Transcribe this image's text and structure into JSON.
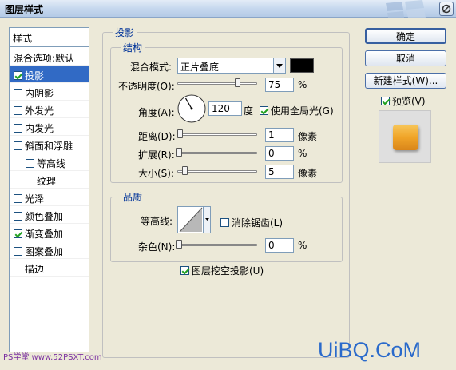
{
  "window": {
    "title": "图层样式"
  },
  "styles_list": {
    "header": "样式",
    "items": [
      {
        "label": "混合选项:默认",
        "checkbox": false,
        "checked": false,
        "selected": false,
        "indent": false
      },
      {
        "label": "投影",
        "checkbox": true,
        "checked": true,
        "selected": true,
        "indent": false
      },
      {
        "label": "内阴影",
        "checkbox": true,
        "checked": false,
        "selected": false,
        "indent": false
      },
      {
        "label": "外发光",
        "checkbox": true,
        "checked": false,
        "selected": false,
        "indent": false
      },
      {
        "label": "内发光",
        "checkbox": true,
        "checked": false,
        "selected": false,
        "indent": false
      },
      {
        "label": "斜面和浮雕",
        "checkbox": true,
        "checked": false,
        "selected": false,
        "indent": false
      },
      {
        "label": "等高线",
        "checkbox": true,
        "checked": false,
        "selected": false,
        "indent": true
      },
      {
        "label": "纹理",
        "checkbox": true,
        "checked": false,
        "selected": false,
        "indent": true
      },
      {
        "label": "光泽",
        "checkbox": true,
        "checked": false,
        "selected": false,
        "indent": false
      },
      {
        "label": "颜色叠加",
        "checkbox": true,
        "checked": false,
        "selected": false,
        "indent": false
      },
      {
        "label": "渐变叠加",
        "checkbox": true,
        "checked": true,
        "selected": false,
        "indent": false
      },
      {
        "label": "图案叠加",
        "checkbox": true,
        "checked": false,
        "selected": false,
        "indent": false
      },
      {
        "label": "描边",
        "checkbox": true,
        "checked": false,
        "selected": false,
        "indent": false
      }
    ]
  },
  "drop_shadow": {
    "section_title": "投影",
    "structure": {
      "title": "结构",
      "blend_mode_label": "混合模式:",
      "blend_mode_value": "正片叠底",
      "shadow_color": "#000000",
      "opacity_label": "不透明度(O):",
      "opacity_value": "75",
      "opacity_unit": "%",
      "opacity_fraction": 0.75,
      "angle_label": "角度(A):",
      "angle_value": "120",
      "angle_unit": "度",
      "use_global_light_label": "使用全局光(G)",
      "use_global_light_checked": true,
      "distance_label": "距离(D):",
      "distance_value": "1",
      "distance_unit": "像素",
      "spread_label": "扩展(R):",
      "spread_value": "0",
      "spread_unit": "%",
      "size_label": "大小(S):",
      "size_value": "5",
      "size_unit": "像素"
    },
    "quality": {
      "title": "品质",
      "contour_label": "等高线:",
      "anti_alias_label": "消除锯齿(L)",
      "anti_alias_checked": false,
      "noise_label": "杂色(N):",
      "noise_value": "0",
      "noise_unit": "%"
    },
    "knockout_label": "图层挖空投影(U)",
    "knockout_checked": true
  },
  "buttons": {
    "ok": "确定",
    "cancel": "取消",
    "new_style": "新建样式(W)...",
    "preview_label": "预览(V)",
    "preview_checked": true
  },
  "watermarks": {
    "left": "PS学堂 www.52PSXT.com",
    "right": "UiBQ.CoM"
  },
  "colors": {
    "selection": "#316ac5",
    "section_blue": "#003399",
    "preview_swatch": "#f0a428"
  }
}
